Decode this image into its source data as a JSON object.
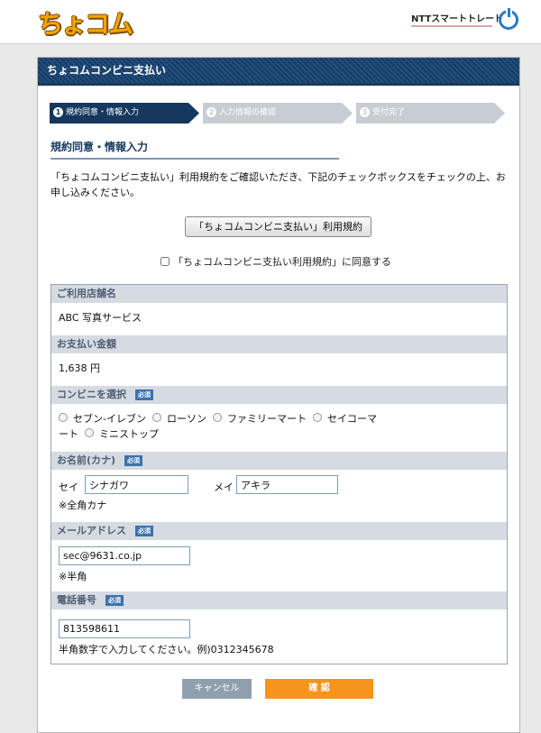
{
  "header": {
    "logo_text": "ちょコム",
    "provider": "NTTスマートトレード",
    "icon": "power-icon"
  },
  "panel_title": "ちょコムコンビニ支払い",
  "steps": [
    {
      "num": "1",
      "label": "規約同意・情報入力",
      "state": "active"
    },
    {
      "num": "2",
      "label": "入力情報の確認",
      "state": "inactive"
    },
    {
      "num": "3",
      "label": "受付完了",
      "state": "inactive"
    }
  ],
  "section_heading": "規約同意・情報入力",
  "intro_text": "「ちょコムコンビニ支払い」利用規約をご確認いただき、下記のチェックボックスをチェックの上、お申し込みください。",
  "terms_button_label": "「ちょコムコンビニ支払い」利用規約",
  "agree_label": "「ちょコムコンビニ支払い利用規約」に同意する",
  "required_badge": "必須",
  "fields": {
    "store": {
      "label": "ご利用店舗名",
      "value": "ABC 写真サービス"
    },
    "amount": {
      "label": "お支払い金額",
      "value": "1,638 円"
    },
    "convenience": {
      "label": "コンビニを選択",
      "options": [
        "セブン-イレブン",
        "ローソン",
        "ファミリーマート",
        "セイコーマート",
        "ミニストップ"
      ]
    },
    "name": {
      "label": "お名前(カナ)",
      "sei_label": "セイ",
      "sei_value": "シナガワ",
      "mei_label": "メイ",
      "mei_value": "アキラ",
      "note": "※全角カナ"
    },
    "email": {
      "label": "メールアドレス",
      "value": "sec@9631.co.jp",
      "note": "※半角"
    },
    "phone": {
      "label": "電話番号",
      "value": "813598611",
      "note": "半角数字で入力してください。例)0312345678"
    }
  },
  "buttons": {
    "cancel": "キャンセル",
    "confirm": "確 認"
  },
  "colors": {
    "brand": "#f5a400",
    "navy": "#16375e",
    "confirm": "#f7941d",
    "cancel": "#8f9fae",
    "field_header": "#d6dbe1"
  }
}
